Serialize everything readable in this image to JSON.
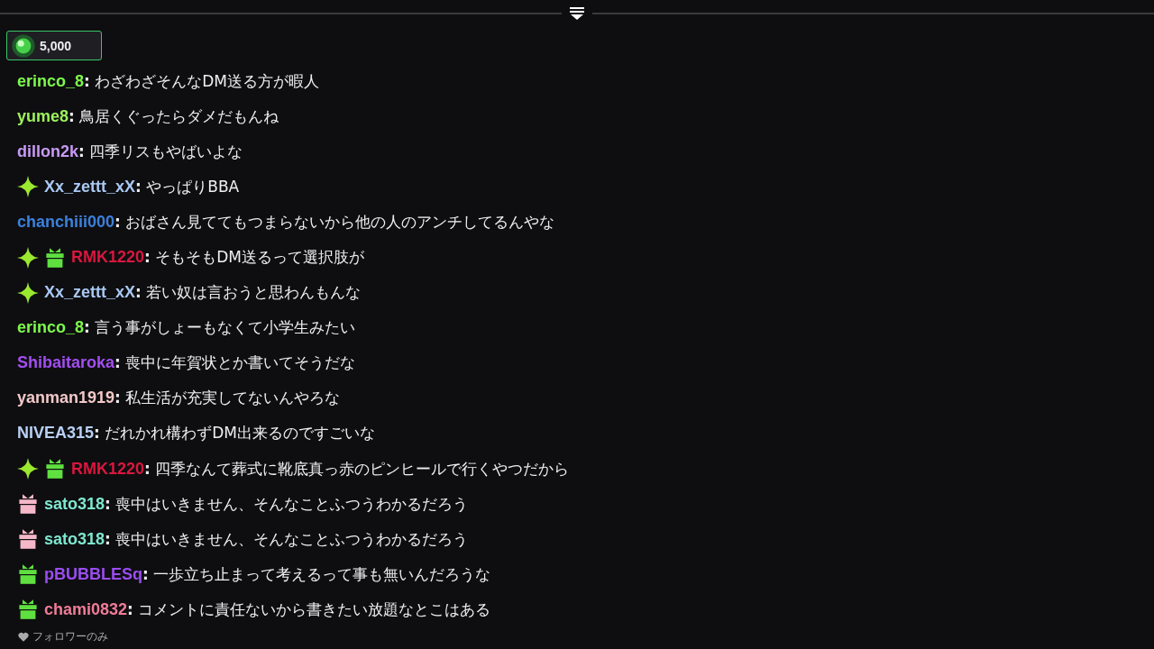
{
  "points": {
    "value": "5,000"
  },
  "messages": [
    {
      "user": "erinco_8",
      "color": "#7df94c",
      "text": "**:** わざわざそんなDM送る方が暇人"
    },
    {
      "user": "yume8",
      "color": "#9ef25c",
      "text": "**:** 鳥居くぐったらダメだもんね"
    },
    {
      "user": "dillon2k",
      "color": "#c89af5",
      "text": "**:** 四季リスもやばいよな"
    },
    {
      "badges": [
        {
          "kind": "sparkle",
          "color": "#9be830"
        }
      ],
      "user": "Xx_zettt_xX",
      "color": "#a9c8f3",
      "text": "**:** やっぱりBBA"
    },
    {
      "user": "chanchiii000",
      "color": "#3b80dc",
      "text": "**:** おばさん見ててもつまらないから他の人のアンチしてるんやな"
    },
    {
      "badges": [
        {
          "kind": "sparkle",
          "color": "#9be830"
        },
        {
          "kind": "gift",
          "color": "#5fe040"
        }
      ],
      "user": "RMK1220",
      "color": "#d9173f",
      "text": "**:** そもそもDM送るって選択肢が"
    },
    {
      "badges": [
        {
          "kind": "sparkle",
          "color": "#9be830"
        }
      ],
      "user": "Xx_zettt_xX",
      "color": "#a9c8f3",
      "text": "**:** 若い奴は言おうと思わんもんな"
    },
    {
      "user": "erinco_8",
      "color": "#7df94c",
      "text": "**:** 言う事がしょーもなくて小学生みたい"
    },
    {
      "user": "Shibaitaroka",
      "color": "#a24ef0",
      "text": "**:** 喪中に年賀状とか書いてそうだな"
    },
    {
      "user": "yanman1919",
      "color": "#f2c8c8",
      "text": "**:** 私生活が充実してないんやろな"
    },
    {
      "user": "NIVEA315",
      "color": "#b8d0f5",
      "text": "**:** だれかれ構わずDM出来るのですごいな"
    },
    {
      "badges": [
        {
          "kind": "sparkle",
          "color": "#9be830"
        },
        {
          "kind": "gift",
          "color": "#5fe040"
        }
      ],
      "user": "RMK1220",
      "color": "#d9173f",
      "text": "**:** 四季なんて葬式に靴底真っ赤のピンヒールで行くやつだから"
    },
    {
      "badges": [
        {
          "kind": "gift",
          "color": "#f5b8c8"
        }
      ],
      "user": "sato318",
      "color": "#7fe8d0",
      "text": "**:** 喪中はいきません、そんなことふつうわかるだろう"
    },
    {
      "badges": [
        {
          "kind": "gift",
          "color": "#f5b8c8"
        }
      ],
      "user": "sato318",
      "color": "#7fe8d0",
      "text": "**:** 喪中はいきません、そんなことふつうわかるだろう"
    },
    {
      "badges": [
        {
          "kind": "gift",
          "color": "#5fe040"
        }
      ],
      "user": "pBUBBLESq",
      "color": "#9b4df2",
      "text": "**:** 一歩立ち止まって考えるって事も無いんだろうな"
    },
    {
      "badges": [
        {
          "kind": "gift",
          "color": "#5fe040"
        }
      ],
      "user": "chami0832",
      "color": "#f07c98",
      "text": "**:** コメントに責任ないから書きたい放題なとこはある"
    }
  ],
  "footer": {
    "label": "フォロワーのみ"
  }
}
